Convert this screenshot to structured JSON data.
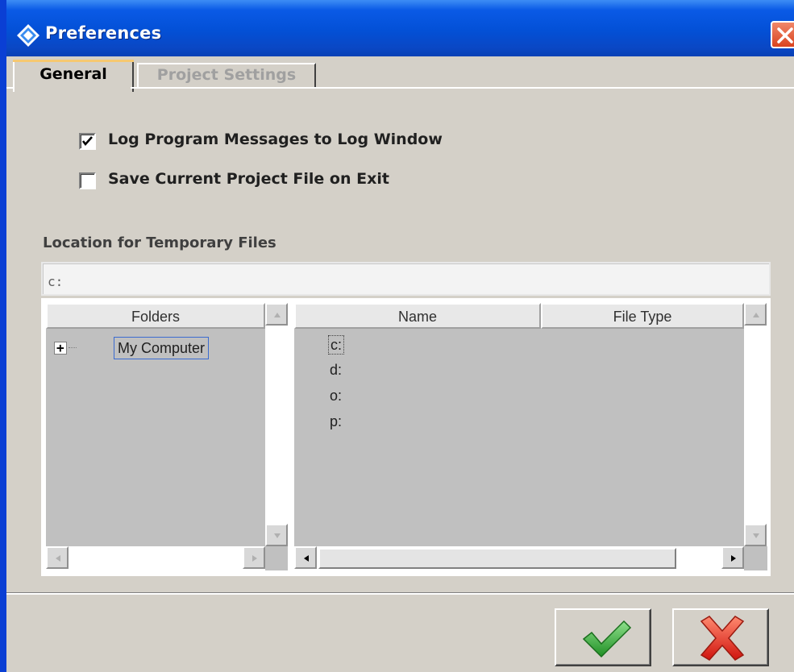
{
  "window": {
    "title": "Preferences"
  },
  "tabs": [
    {
      "label": "General",
      "active": true
    },
    {
      "label": "Project Settings",
      "active": false
    }
  ],
  "options": {
    "log_messages": {
      "label": "Log Program Messages to Log Window",
      "checked": true
    },
    "save_on_exit": {
      "label": "Save Current Project File on Exit",
      "checked": false
    }
  },
  "temp_location": {
    "label": "Location for Temporary Files",
    "path": "c:"
  },
  "folders_pane": {
    "header": "Folders",
    "tree": [
      {
        "label": "My Computer",
        "expander": "+"
      }
    ]
  },
  "files_pane": {
    "columns": [
      "Name",
      "File Type"
    ],
    "drives": [
      "c:",
      "d:",
      "o:",
      "p:"
    ],
    "selected": "c:"
  },
  "colors": {
    "titlebar": "#0350d6",
    "close": "#d9431e",
    "ok": "#2fa832",
    "cancel": "#e0241c"
  },
  "icons": {
    "title": "diamond-app-icon",
    "close": "close-icon",
    "ok": "checkmark-icon",
    "cancel": "red-x-icon"
  }
}
